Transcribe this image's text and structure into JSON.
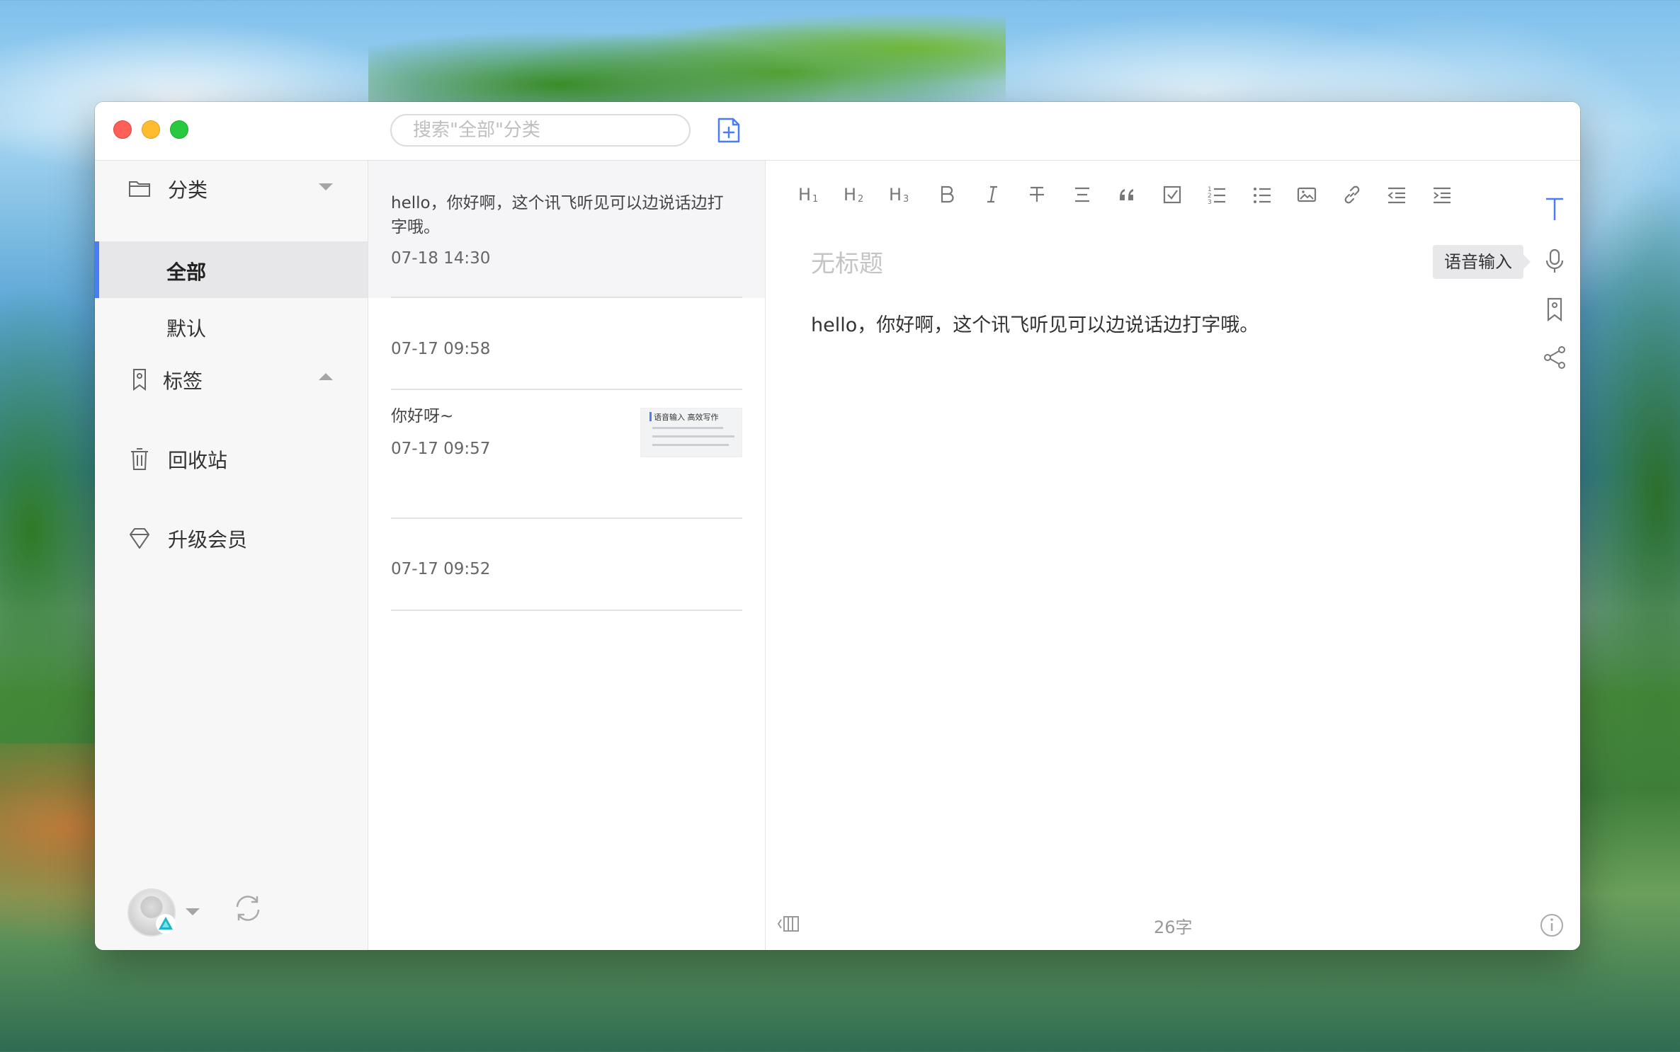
{
  "window": {
    "search_placeholder": "搜索\"全部\"分类"
  },
  "sidebar": {
    "category_label": "分类",
    "categories": [
      {
        "label": "全部",
        "active": true
      },
      {
        "label": "默认",
        "active": false
      }
    ],
    "tags_label": "标签",
    "trash_label": "回收站",
    "upgrade_label": "升级会员"
  },
  "notes": [
    {
      "preview": "hello，你好啊，这个讯飞听见可以边说话边打字哦。",
      "time": "07-18 14:30",
      "selected": true
    },
    {
      "preview": "",
      "time": "07-17 09:58",
      "selected": false
    },
    {
      "preview": "你好呀~",
      "time": "07-17 09:57",
      "selected": false,
      "thumbnail_title": "语音输入 高效写作"
    },
    {
      "preview": "",
      "time": "07-17 09:52",
      "selected": false
    }
  ],
  "toolbar": {
    "h1": "H1",
    "h2": "H2",
    "h3": "H3",
    "bold": "B",
    "italic": "I",
    "quote": "❝",
    "items": [
      "H1",
      "H2",
      "H3",
      "bold",
      "italic",
      "strikethrough",
      "align",
      "quote",
      "checkbox",
      "ordered-list",
      "bullet-list",
      "image",
      "link",
      "outdent",
      "indent"
    ]
  },
  "editor": {
    "title_placeholder": "无标题",
    "body": "hello，你好啊，这个讯飞听见可以边说话边打字哦。",
    "voice_tooltip": "语音输入",
    "word_count": "26字"
  },
  "colors": {
    "accent": "#4a7cf4",
    "sidebar_bg": "#f7f7f8",
    "active_item_bg": "#e7e7ea"
  }
}
